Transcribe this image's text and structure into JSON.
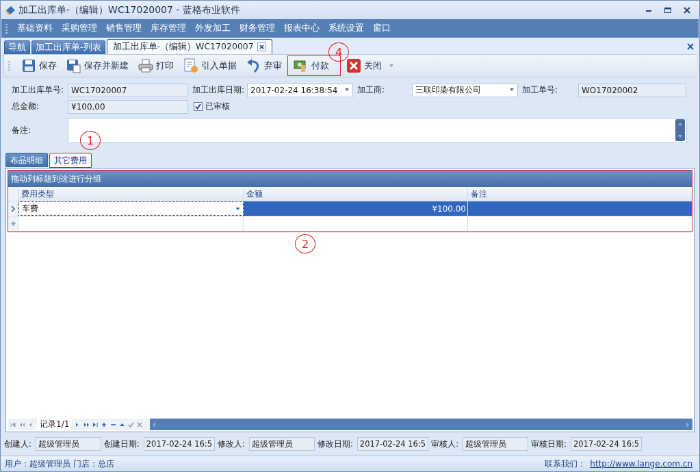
{
  "window": {
    "title": "加工出库单-（编辑）WC17020007 - 蓝格布业软件"
  },
  "menu": [
    "基础资料",
    "采购管理",
    "销售管理",
    "库存管理",
    "外发加工",
    "财务管理",
    "报表中心",
    "系统设置",
    "窗口"
  ],
  "doc_tabs": [
    {
      "label": "导航",
      "selected": false,
      "closable": false
    },
    {
      "label": "加工出库单-列表",
      "selected": false,
      "closable": false
    },
    {
      "label": "加工出库单-（编辑）WC17020007",
      "selected": true,
      "closable": true
    }
  ],
  "toolbar": [
    {
      "kind": "save",
      "label": "保存",
      "highlighted": false
    },
    {
      "kind": "save-new",
      "label": "保存并新建",
      "highlighted": false
    },
    {
      "kind": "print",
      "label": "打印",
      "highlighted": false
    },
    {
      "kind": "import",
      "label": "引入单据",
      "highlighted": false
    },
    {
      "kind": "undo",
      "label": "弃审",
      "highlighted": false
    },
    {
      "kind": "pay",
      "label": "付款",
      "highlighted": true,
      "callout": "4"
    },
    {
      "kind": "close",
      "label": "关闭",
      "highlighted": false
    }
  ],
  "form": {
    "order_no": {
      "label": "加工出库单号:",
      "value": "WC17020007"
    },
    "date": {
      "label": "加工出库日期:",
      "value": "2017-02-24 16:38:54"
    },
    "processor": {
      "label": "加工商:",
      "value": "三联印染有限公司"
    },
    "process_no": {
      "label": "加工单号:",
      "value": "WO17020002"
    },
    "total": {
      "label": "总金额:",
      "value": "¥100.00"
    },
    "audited": {
      "label": "已审核",
      "checked": true
    },
    "remark": {
      "label": "备注:"
    }
  },
  "detail_tabs": [
    {
      "label": "布品明细",
      "selected": false,
      "highlighted": false
    },
    {
      "label": "其它费用",
      "selected": true,
      "highlighted": true,
      "callout": "1"
    }
  ],
  "grid": {
    "highlighted": true,
    "callout": "2",
    "group_panel": "拖动列标题到这进行分组",
    "columns": [
      "费用类型",
      "金额",
      "备注"
    ],
    "rows": [
      {
        "selected": true,
        "cells": [
          "车费",
          "¥100.00",
          ""
        ]
      }
    ]
  },
  "navigator": {
    "record": "记录1/1"
  },
  "audit": [
    {
      "label": "创建人:",
      "value": "超级管理员"
    },
    {
      "label": "创建日期:",
      "value": "2017-02-24 16:5"
    },
    {
      "label": "修改人:",
      "value": "超级管理员"
    },
    {
      "label": "修改日期:",
      "value": "2017-02-24 16:5"
    },
    {
      "label": "审核人:",
      "value": "超级管理员"
    },
    {
      "label": "审核日期:",
      "value": "2017-02-24 16:5"
    }
  ],
  "status_bar": {
    "user": "用户：超级管理员  门店：总店",
    "contact_label": "联系我们：",
    "contact_link": "http://www.lange.com.cn"
  }
}
